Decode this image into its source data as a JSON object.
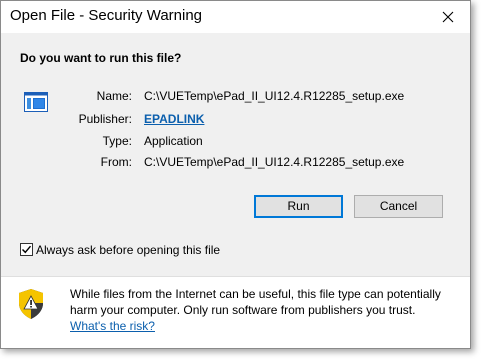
{
  "window": {
    "title": "Open File - Security Warning"
  },
  "dialog": {
    "question": "Do you want to run this file?",
    "fields": {
      "name_label": "Name:",
      "name_value": "C:\\VUETemp\\ePad_II_UI12.4.R12285_setup.exe",
      "publisher_label": "Publisher:",
      "publisher_value": "EPADLINK",
      "type_label": "Type:",
      "type_value": "Application",
      "from_label": "From:",
      "from_value": "C:\\VUETemp\\ePad_II_UI12.4.R12285_setup.exe"
    },
    "buttons": {
      "run_label": "Run",
      "cancel_label": "Cancel"
    },
    "checkbox": {
      "label": "Always ask before opening this file",
      "checked": true
    }
  },
  "footer": {
    "warning_text": "While files from the Internet can be useful, this file type can potentially harm your computer. Only run software from publishers you trust.",
    "risk_link": "What's the risk?"
  },
  "icons": {
    "close": "close-icon",
    "file": "application-file-icon",
    "shield": "warning-shield-icon",
    "check": "checkmark-icon"
  },
  "colors": {
    "link": "#0b5fad",
    "content_bg": "#f0f0f0",
    "button_bg": "#e1e1e1",
    "default_button_border": "#0078d7",
    "shield_yellow": "#f5c400",
    "shield_dark": "#3b3b3b"
  }
}
